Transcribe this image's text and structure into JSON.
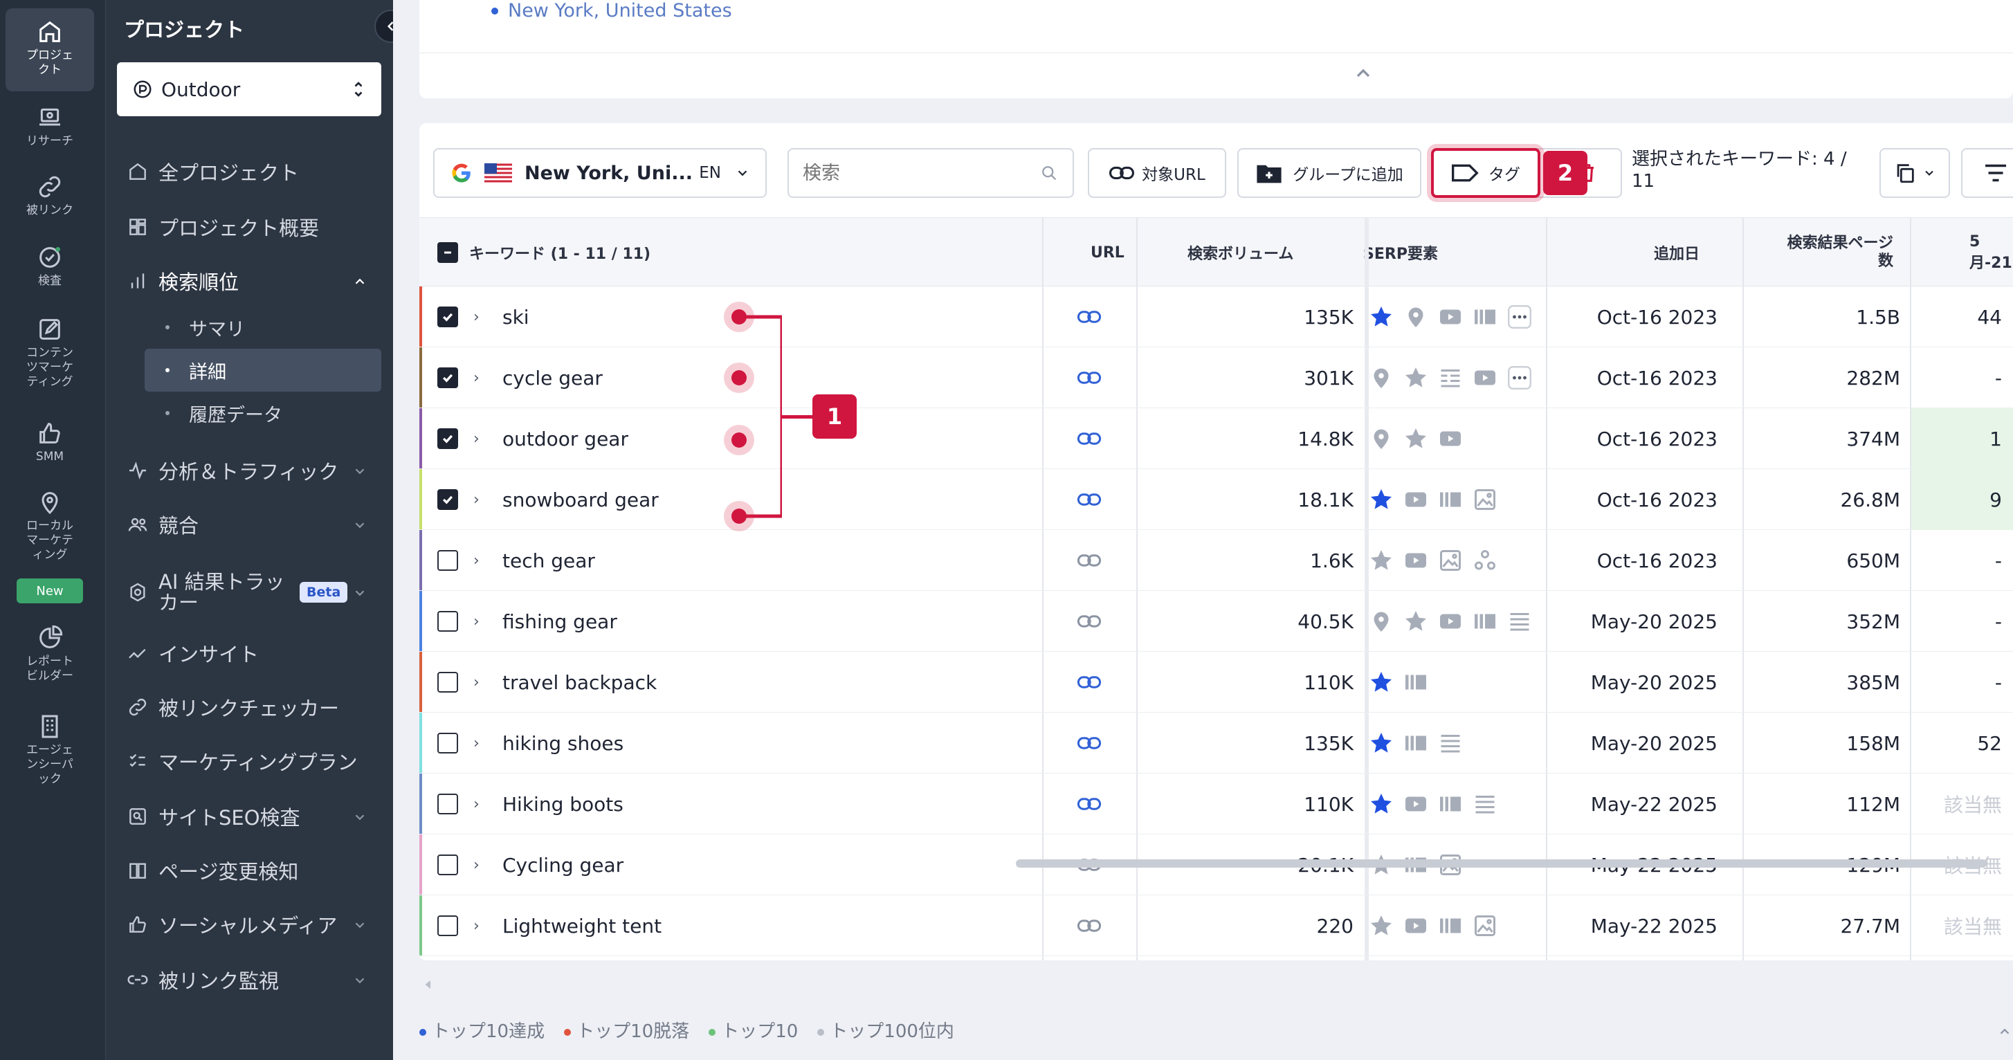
{
  "rail": [
    {
      "label": "プロジェクト",
      "icon": "home-icon",
      "active": true
    },
    {
      "label": "リサーチ",
      "icon": "laptop-icon"
    },
    {
      "label": "被リンク",
      "icon": "link-icon"
    },
    {
      "label": "検査",
      "icon": "check-circle-icon"
    },
    {
      "label": "コンテンツマーケティング",
      "icon": "edit-icon"
    },
    {
      "label": "SMM",
      "icon": "thumbs-up-icon"
    },
    {
      "label": "ローカルマーケティング",
      "icon": "location-pin-icon"
    },
    {
      "label": "レポートビルダー",
      "icon": "pie-chart-icon"
    },
    {
      "label": "エージェンシーパック",
      "icon": "building-icon"
    }
  ],
  "rail_new_badge": "New",
  "sidebar": {
    "title": "プロジェクト",
    "project": "Outdoor",
    "items": [
      {
        "label": "全プロジェクト"
      },
      {
        "label": "プロジェクト概要"
      },
      {
        "label": "検索順位"
      },
      {
        "label": "分析＆トラフィック"
      },
      {
        "label": "競合"
      },
      {
        "label": "AI 結果トラッカー"
      },
      {
        "label": "インサイト"
      },
      {
        "label": "被リンクチェッカー"
      },
      {
        "label": "マーケティングプラン"
      },
      {
        "label": "サイトSEO検査"
      },
      {
        "label": "ページ変更検知"
      },
      {
        "label": "ソーシャルメディア"
      },
      {
        "label": "被リンク監視"
      }
    ],
    "subitems": [
      "サマリ",
      "詳細",
      "履歴データ"
    ],
    "beta": "Beta"
  },
  "top_card": {
    "location": "New York, United States"
  },
  "toolbar": {
    "location": "New York, Uni...",
    "lang": "EN",
    "search_placeholder": "検索",
    "target_url": "対象URL",
    "add_group": "グループに追加",
    "tag": "タグ",
    "selected_line1": "選択されたキーワード: 4 /",
    "selected_line2": "11"
  },
  "columns": {
    "keyword": "キーワード (1 - 11 / 11)",
    "url": "URL",
    "volume": "検索ボリューム",
    "serp": "SERP要素",
    "added": "追加日",
    "results_l1": "検索結果ページ",
    "results_l2": "数",
    "date": "5月-21"
  },
  "rows": [
    {
      "keyword": "ski",
      "volume": "135K",
      "added": "Oct-16 2023",
      "results": "1.5B",
      "pos": "44",
      "checked": true,
      "bar": "#e0533d",
      "serp": [
        "star",
        "pin",
        "video",
        "carousel",
        "more"
      ],
      "url_active": true,
      "pos_bg": false
    },
    {
      "keyword": "cycle gear",
      "volume": "301K",
      "added": "Oct-16 2023",
      "results": "282M",
      "pos": "-",
      "checked": true,
      "bar": "#8a6a3e",
      "serp": [
        "pin-g",
        "star-g",
        "list",
        "video",
        "more"
      ],
      "url_active": true,
      "pos_bg": false
    },
    {
      "keyword": "outdoor gear",
      "volume": "14.8K",
      "added": "Oct-16 2023",
      "results": "374M",
      "pos": "1",
      "checked": true,
      "bar": "#8a5aa8",
      "serp": [
        "pin-g",
        "star-g",
        "video"
      ],
      "url_active": true,
      "pos_bg": true
    },
    {
      "keyword": "snowboard gear",
      "volume": "18.1K",
      "added": "Oct-16 2023",
      "results": "26.8M",
      "pos": "9",
      "checked": true,
      "bar": "#c5e06a",
      "serp": [
        "star",
        "video",
        "carousel",
        "image"
      ],
      "url_active": true,
      "pos_bg": true
    },
    {
      "keyword": "tech gear",
      "volume": "1.6K",
      "added": "Oct-16 2023",
      "results": "650M",
      "pos": "-",
      "checked": false,
      "bar": "#7b6fae",
      "serp": [
        "star-g",
        "video",
        "image",
        "nodes"
      ],
      "url_active": false,
      "pos_bg": false
    },
    {
      "keyword": "fishing gear",
      "volume": "40.5K",
      "added": "May-20 2025",
      "results": "352M",
      "pos": "-",
      "checked": false,
      "bar": "#4b82e0",
      "serp": [
        "pin-g",
        "star-g",
        "video",
        "carousel",
        "lines"
      ],
      "url_active": false,
      "pos_bg": false
    },
    {
      "keyword": "travel backpack",
      "volume": "110K",
      "added": "May-20 2025",
      "results": "385M",
      "pos": "-",
      "checked": false,
      "bar": "#d9603e",
      "serp": [
        "star",
        "carousel"
      ],
      "url_active": true,
      "pos_bg": false
    },
    {
      "keyword": "hiking shoes",
      "volume": "135K",
      "added": "May-20 2025",
      "results": "158M",
      "pos": "52",
      "checked": false,
      "bar": "#7fe0e0",
      "serp": [
        "star",
        "carousel",
        "lines"
      ],
      "url_active": true,
      "pos_bg": false
    },
    {
      "keyword": "Hiking boots",
      "volume": "110K",
      "added": "May-22 2025",
      "results": "112M",
      "pos": "該当無",
      "checked": false,
      "bar": "#6f8cc8",
      "serp": [
        "star",
        "video",
        "carousel",
        "lines"
      ],
      "url_active": true,
      "pos_bg": false
    },
    {
      "keyword": "Cycling gear",
      "volume": "20.1K",
      "added": "May-22 2025",
      "results": "129M",
      "pos": "該当無",
      "checked": false,
      "bar": "#e6a3c8",
      "serp": [
        "star-g",
        "carousel",
        "image"
      ],
      "url_active": false,
      "pos_bg": false
    },
    {
      "keyword": "Lightweight tent",
      "volume": "220",
      "added": "May-22 2025",
      "results": "27.7M",
      "pos": "該当無",
      "checked": false,
      "bar": "#7ec98a",
      "serp": [
        "star-g",
        "video",
        "carousel",
        "image"
      ],
      "url_active": false,
      "pos_bg": false
    }
  ],
  "legend": [
    {
      "label": "トップ10達成",
      "color": "#3161d6"
    },
    {
      "label": "トップ10脱落",
      "color": "#e0533d"
    },
    {
      "label": "トップ10",
      "color": "#6cc27a"
    },
    {
      "label": "トップ100位内",
      "color": "#b9bec8"
    }
  ],
  "annotations": {
    "bracket": "1",
    "tag_button": "2"
  }
}
